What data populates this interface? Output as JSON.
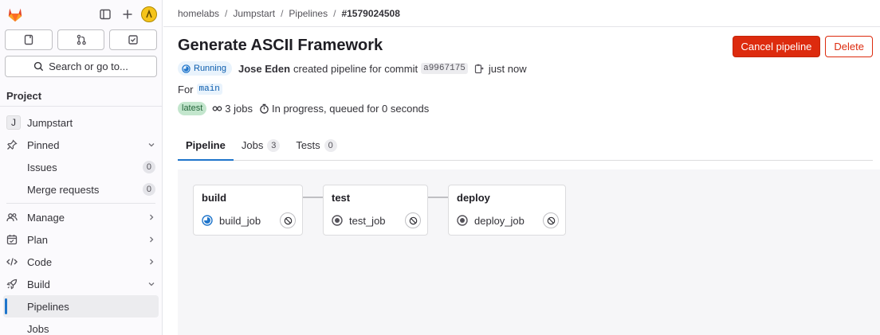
{
  "sidebar": {
    "search_label": "Search or go to...",
    "section_title": "Project",
    "project": {
      "letter": "J",
      "name": "Jumpstart"
    },
    "pinned": {
      "label": "Pinned",
      "items": [
        {
          "label": "Issues",
          "count": "0"
        },
        {
          "label": "Merge requests",
          "count": "0"
        }
      ]
    },
    "nav": [
      {
        "label": "Manage",
        "icon": "users-icon"
      },
      {
        "label": "Plan",
        "icon": "calendar-icon"
      },
      {
        "label": "Code",
        "icon": "code-icon"
      },
      {
        "label": "Build",
        "icon": "rocket-icon"
      }
    ],
    "build_sub": [
      {
        "label": "Pipelines",
        "active": true
      },
      {
        "label": "Jobs",
        "active": false
      }
    ]
  },
  "breadcrumb": {
    "items": [
      "homelabs",
      "Jumpstart",
      "Pipelines"
    ],
    "current": "#1579024508"
  },
  "pipeline": {
    "title": "Generate ASCII Framework",
    "cancel_label": "Cancel pipeline",
    "delete_label": "Delete",
    "status": "Running",
    "author": "Jose Eden",
    "created_text": "created pipeline for commit",
    "commit": "a9967175",
    "time": "just now",
    "for_label": "For",
    "branch": "main",
    "latest_badge": "latest",
    "jobs_count": "3 jobs",
    "progress_text": "In progress, queued for 0 seconds"
  },
  "tabs": [
    {
      "label": "Pipeline",
      "count": null,
      "active": true
    },
    {
      "label": "Jobs",
      "count": "3",
      "active": false
    },
    {
      "label": "Tests",
      "count": "0",
      "active": false
    }
  ],
  "stages": [
    {
      "name": "build",
      "job": "build_job",
      "status": "running"
    },
    {
      "name": "test",
      "job": "test_job",
      "status": "created"
    },
    {
      "name": "deploy",
      "job": "deploy_job",
      "status": "created"
    }
  ],
  "colors": {
    "accent": "#1f75cb",
    "danger": "#dd2b0e",
    "running": "#1f75cb",
    "latest_bg": "#c3e6cd"
  }
}
